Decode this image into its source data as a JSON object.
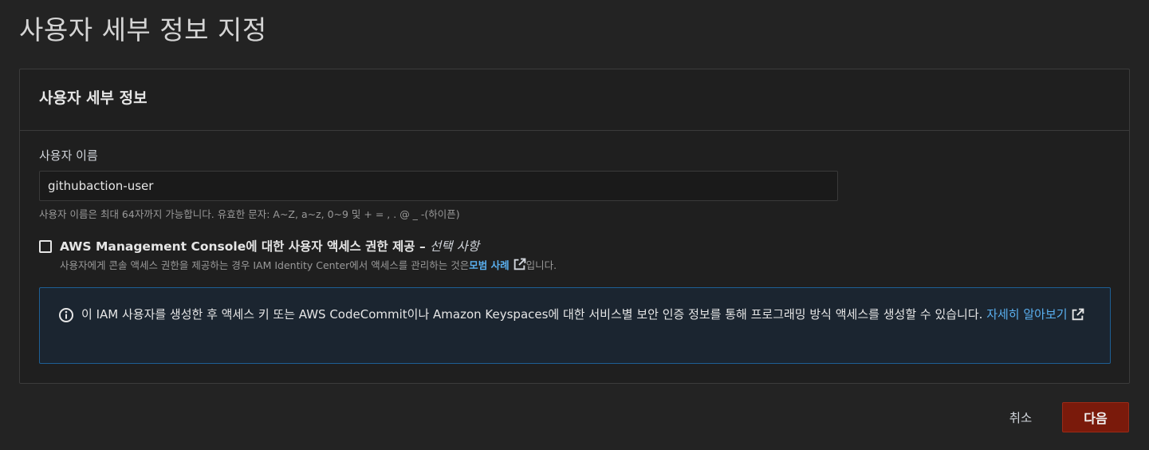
{
  "page": {
    "title": "사용자 세부 정보 지정"
  },
  "panel": {
    "title": "사용자 세부 정보",
    "username": {
      "label": "사용자 이름",
      "value": "githubaction-user",
      "hint": "사용자 이름은 최대 64자까지 가능합니다. 유효한 문자: A~Z, a~z, 0~9 및 + = , . @ _ -(하이픈)"
    },
    "console_access": {
      "checked": false,
      "label": "AWS Management Console에 대한 사용자 액세스 권한 제공 – ",
      "optional": "선택 사항",
      "description_prefix": "사용자에게 콘솔 액세스 권한을 제공하는 경우 IAM Identity Center에서 액세스를 관리하는 것은 ",
      "description_link": "모범 사례",
      "description_suffix": "입니다."
    },
    "info": {
      "text": "이 IAM 사용자를 생성한 후 액세스 키 또는 AWS CodeCommit이나 Amazon Keyspaces에 대한 서비스별 보안 인증 정보를 통해 프로그래밍 방식 액세스를 생성할 수 있습니다. ",
      "link": "자세히 알아보기"
    }
  },
  "actions": {
    "cancel_label": "취소",
    "next_label": "다음"
  },
  "colors": {
    "background": "#232323",
    "panel": "#1f1f1f",
    "link": "#5ab0f0",
    "info_border": "#1e5f94",
    "primary_button": "#7a1a0b"
  }
}
